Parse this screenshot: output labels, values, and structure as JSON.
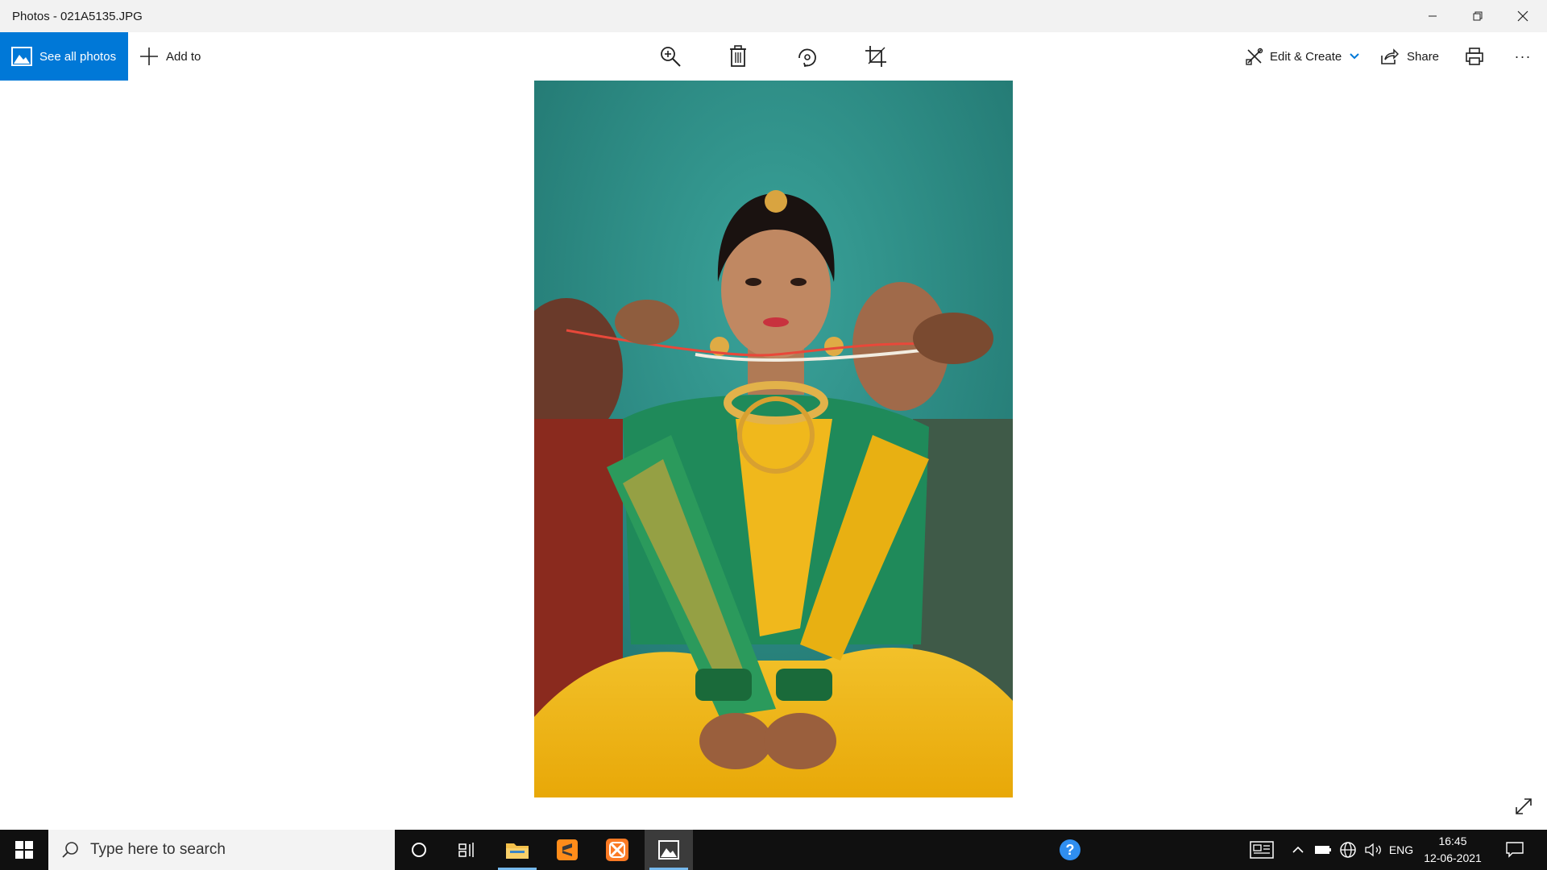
{
  "window": {
    "title": "Photos - 021A5135.JPG"
  },
  "toolbar": {
    "see_all_label": "See all photos",
    "add_to_label": "Add to",
    "edit_create_label": "Edit & Create",
    "share_label": "Share",
    "more_label": "···"
  },
  "taskbar": {
    "search_placeholder": "Type here to search",
    "language": "ENG",
    "time": "16:45",
    "date": "12-06-2021"
  },
  "colors": {
    "accent": "#0078d7",
    "taskbar": "#101010",
    "titlebar": "#f2f2f2"
  },
  "icons": {
    "see_all": "gallery-icon",
    "add_to": "plus-icon",
    "zoom": "zoom-in-icon",
    "delete": "trash-icon",
    "rotate": "rotate-icon",
    "crop": "crop-icon",
    "edit": "edit-create-icon",
    "share": "share-icon",
    "print": "printer-icon"
  }
}
